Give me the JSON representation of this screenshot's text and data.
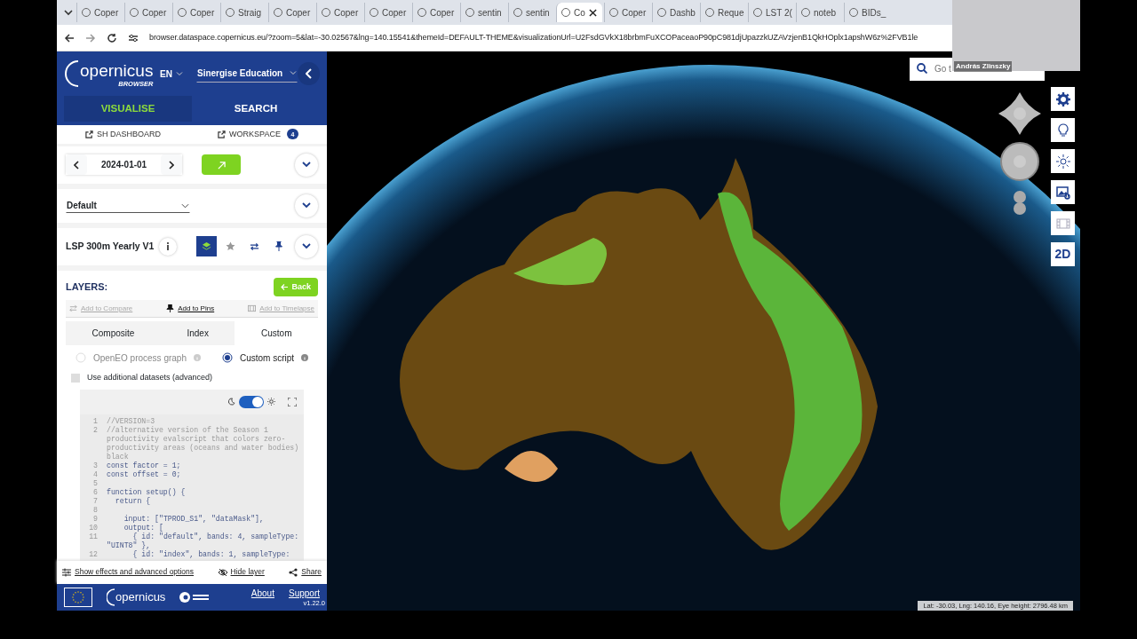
{
  "browser": {
    "tabs": [
      {
        "label": "Coper",
        "selected": false
      },
      {
        "label": "Coper",
        "selected": false
      },
      {
        "label": "Coper",
        "selected": false
      },
      {
        "label": "Straig",
        "selected": false
      },
      {
        "label": "Coper",
        "selected": false
      },
      {
        "label": "Coper",
        "selected": false
      },
      {
        "label": "Coper",
        "selected": false
      },
      {
        "label": "Coper",
        "selected": false
      },
      {
        "label": "sentin",
        "selected": false
      },
      {
        "label": "sentin",
        "selected": false
      },
      {
        "label": "Co",
        "selected": true
      },
      {
        "label": "Coper",
        "selected": false
      },
      {
        "label": "Dashb",
        "selected": false
      },
      {
        "label": "Reque",
        "selected": false
      },
      {
        "label": "LST 2(",
        "selected": false
      },
      {
        "label": "noteb",
        "selected": false
      },
      {
        "label": "BIDs_",
        "selected": false
      }
    ],
    "address": "browser.dataspace.copernicus.eu/?zoom=5&lat=-30.02567&lng=140.15541&themeId=DEFAULT-THEME&visualizationUrl=U2FsdGVkX18brbmFuXCOPaceaoP90pC981djUpazzkUZAVzjenB1QkHOplx1apshW6z%2FVB1le"
  },
  "video_overlay": {
    "name": "András Zlinszky"
  },
  "sidebar": {
    "logo_text": "opernicus",
    "logo_subtitle": "BROWSER",
    "language": "EN",
    "account": "Sinergise Education",
    "tabs": [
      {
        "label": "VISUALISE",
        "selected": true
      },
      {
        "label": "SEARCH",
        "selected": false
      }
    ],
    "links": [
      {
        "label": "SH DASHBOARD"
      },
      {
        "label": "WORKSPACE",
        "badge": "4"
      }
    ],
    "date": "2024-01-01",
    "theme": "Default",
    "layer_title": "LSP 300m Yearly V1",
    "layers_heading": "LAYERS:",
    "back_button": "Back",
    "actions": [
      {
        "label": "Add to Compare",
        "disabled": true
      },
      {
        "label": "Add to Pins",
        "disabled": false
      },
      {
        "label": "Add to Timelapse",
        "disabled": true
      }
    ],
    "mode_tabs": [
      {
        "label": "Composite",
        "selected": false
      },
      {
        "label": "Index",
        "selected": false
      },
      {
        "label": "Custom",
        "selected": true
      }
    ],
    "script_types": [
      {
        "label": "OpenEO process graph",
        "selected": false,
        "disabled": true
      },
      {
        "label": "Custom script",
        "selected": true,
        "disabled": false
      }
    ],
    "additional_datasets": {
      "label": "Use additional datasets (advanced)",
      "checked": false
    },
    "light_theme": {
      "on": true
    },
    "code_lines": [
      {
        "number": "1",
        "text": "//VERSION=3",
        "kind": "comment"
      },
      {
        "number": "2",
        "text": "//alternative version of the Season 1 productivity evalscript that colors zero-productivity areas (oceans and water bodies) black",
        "kind": "comment"
      },
      {
        "number": "3",
        "text": "const factor = 1;",
        "kind": "code"
      },
      {
        "number": "4",
        "text": "const offset = 0;",
        "kind": "code"
      },
      {
        "number": "5",
        "kind": "code"
      },
      {
        "number": "6",
        "text": "function setup() {",
        "kind": "code"
      },
      {
        "number": "7",
        "text": "  return {",
        "kind": "code"
      },
      {
        "number": "8",
        "kind": "code"
      },
      {
        "number": "9",
        "text": "    input: [\"TPROD_S1\", \"dataMask\"],",
        "kind": "code"
      },
      {
        "number": "10",
        "text": "    output: [",
        "kind": "code"
      },
      {
        "number": "11",
        "text": "      { id: \"default\", bands: 4, sampleType: \"UINT8\" },",
        "kind": "code"
      },
      {
        "number": "12",
        "text": "      { id: \"index\", bands: 1, sampleType:",
        "kind": "code"
      }
    ],
    "footer_links": [
      "Show effects and advanced options",
      "Hide layer",
      "Share"
    ],
    "footer_logo_text": "opernicus",
    "bottom_links": [
      "About",
      "Support"
    ],
    "version": "v1.22.0"
  },
  "map": {
    "search_placeholder": "Go t",
    "toolbar": [
      {
        "kind": "icon",
        "disabled": false
      },
      {
        "kind": "icon",
        "disabled": false
      },
      {
        "kind": "icon",
        "disabled": false
      },
      {
        "kind": "icon",
        "disabled": false
      },
      {
        "kind": "icon",
        "disabled": true
      },
      {
        "kind": "text",
        "label": "2D",
        "disabled": false
      }
    ],
    "status": "Lat: -30.03, Lng: 140.16, Eye height: 2796.48 km"
  }
}
